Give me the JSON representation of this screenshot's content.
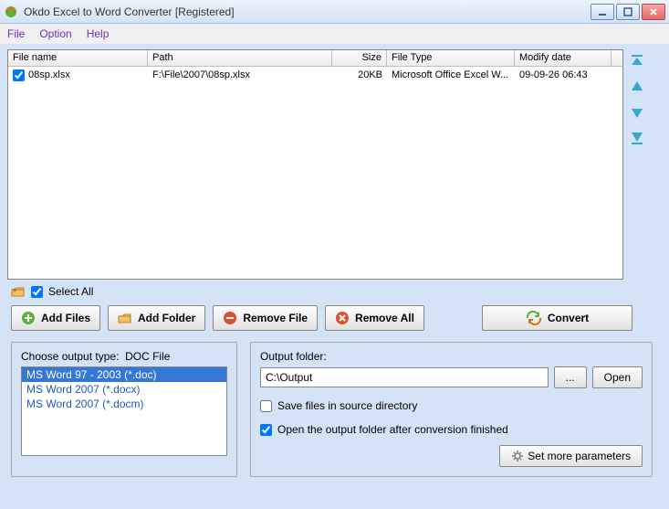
{
  "window": {
    "title": "Okdo Excel to Word Converter [Registered]"
  },
  "menu": {
    "file": "File",
    "option": "Option",
    "help": "Help"
  },
  "headers": {
    "name": "File name",
    "path": "Path",
    "size": "Size",
    "ftype": "File Type",
    "mdate": "Modify date"
  },
  "rows": [
    {
      "checked": true,
      "name": "08sp.xlsx",
      "path": "F:\\File\\2007\\08sp.xlsx",
      "size": "20KB",
      "ftype": "Microsoft Office Excel W...",
      "mdate": "09-09-26 06:43"
    }
  ],
  "selectall": "Select All",
  "buttons": {
    "addfiles": "Add Files",
    "addfolder": "Add Folder",
    "removefile": "Remove File",
    "removeall": "Remove All",
    "convert": "Convert",
    "browse": "...",
    "open": "Open",
    "moreparams": "Set more parameters"
  },
  "outputtype": {
    "label": "Choose output type:",
    "current": "DOC File"
  },
  "formats": [
    "MS Word 97 - 2003 (*.doc)",
    "MS Word 2007 (*.docx)",
    "MS Word 2007 (*.docm)"
  ],
  "outputfolder": {
    "label": "Output folder:",
    "value": "C:\\Output"
  },
  "checks": {
    "savesource": "Save files in source directory",
    "openafter": "Open the output folder after conversion finished"
  }
}
